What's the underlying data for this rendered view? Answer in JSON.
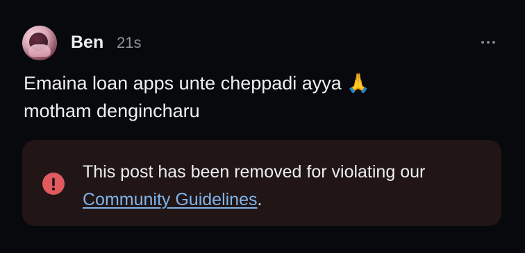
{
  "post": {
    "author": "Ben",
    "time": "21s",
    "text": "Emaina loan apps unte cheppadi ayya 🙏\nmotham dengincharu",
    "more_icon": "more-horizontal-icon"
  },
  "removal_notice": {
    "line1": "This post has been removed for violating our",
    "link_text": "Community Guidelines",
    "suffix": ".",
    "icon": "alert-circle-icon",
    "colors": {
      "card_background": "#211516",
      "alert": "#e05a60",
      "link": "#7fb4ea"
    }
  },
  "colors": {
    "background": "#07090c",
    "primary_text": "#f0f1f3",
    "secondary_text": "#8e9298"
  }
}
